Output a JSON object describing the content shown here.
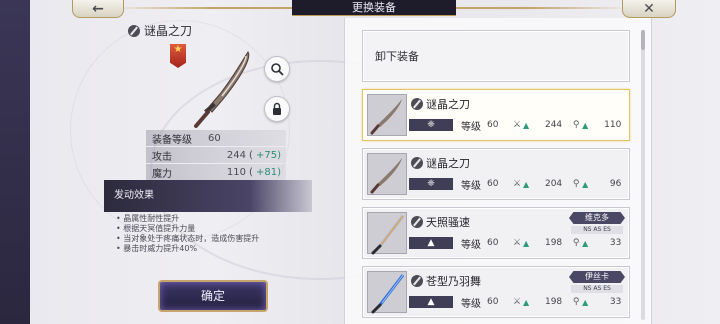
{
  "header": {
    "title": "更换装备",
    "back_icon": "←",
    "close_icon": "✕"
  },
  "detail": {
    "item_name": "谜晶之刀",
    "rank_icon": "★",
    "stats": [
      {
        "label": "装备等级",
        "value": "60",
        "open": "",
        "bonus": ""
      },
      {
        "label": "攻击",
        "value": "244",
        "open": "(",
        "bonus": "+75)"
      },
      {
        "label": "魔力",
        "value": "110",
        "open": "(",
        "bonus": "+81)"
      }
    ],
    "effect_title": "发动效果",
    "effects": [
      "• 晶属性耐性提升",
      "• 根据天冥值提升力量",
      "• 当对象处于疼痛状态时，造成伤害提升",
      "• 暴击时威力提升40%"
    ],
    "confirm_label": "确定"
  },
  "list": {
    "unequip_label": "卸下装备",
    "level_label": "等级",
    "items": [
      {
        "name": "谜晶之刀",
        "type_icon": "❈",
        "level": "60",
        "attack": "244",
        "magic": "110",
        "owner": "",
        "tags": "",
        "selected": true
      },
      {
        "name": "谜晶之刀",
        "type_icon": "❈",
        "level": "60",
        "attack": "204",
        "magic": "96",
        "owner": "",
        "tags": "",
        "selected": false
      },
      {
        "name": "天照骚速",
        "type_icon": "▲",
        "level": "60",
        "attack": "198",
        "magic": "33",
        "owner": "维克多",
        "tags": "NS AS ES",
        "selected": false
      },
      {
        "name": "苍型乃羽舞",
        "type_icon": "▲",
        "level": "60",
        "attack": "198",
        "magic": "33",
        "owner": "伊丝卡",
        "tags": "NS AS ES",
        "selected": false
      }
    ]
  },
  "colors": {
    "accent_gold": "#c6a56a",
    "panel_dark": "#23203d",
    "stat_up": "#2f9a7a"
  }
}
